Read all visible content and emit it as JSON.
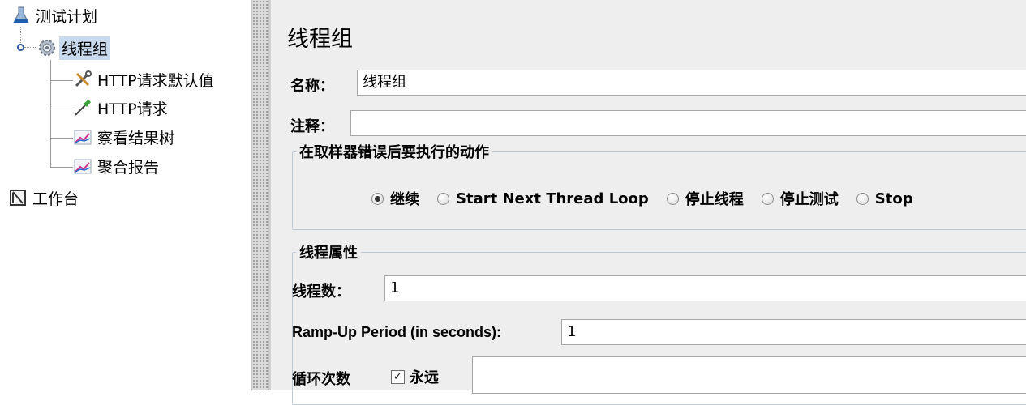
{
  "tree": {
    "items": [
      {
        "label": "测试计划",
        "icon": "test-plan-flask-icon"
      },
      {
        "label": "线程组",
        "icon": "gear-icon"
      },
      {
        "label": "HTTP请求默认值",
        "icon": "tools-wrench-icon"
      },
      {
        "label": "HTTP请求",
        "icon": "pipette-icon"
      },
      {
        "label": "察看结果树",
        "icon": "graph-icon"
      },
      {
        "label": "聚合报告",
        "icon": "graph-icon"
      },
      {
        "label": "工作台",
        "icon": "workbench-icon"
      }
    ]
  },
  "panel": {
    "title": "线程组",
    "name_label": "名称：",
    "name_value": "线程组",
    "comment_label": "注释：",
    "comment_value": "",
    "error_action": {
      "legend": "在取样器错误后要执行的动作",
      "options": [
        "继续",
        "Start Next Thread Loop",
        "停止线程",
        "停止测试",
        "Stop"
      ],
      "selected": "继续"
    },
    "thread_props": {
      "legend": "线程属性",
      "threads_label": "线程数：",
      "threads_value": "1",
      "rampup_label": "Ramp-Up Period (in seconds):",
      "rampup_value": "1",
      "loop_label": "循环次数",
      "forever_label": "永远",
      "forever_checked": true,
      "loop_value": ""
    }
  },
  "colors": {
    "selection": "#c9d9ee",
    "panel_bg": "#eeeeee",
    "border": "#a6a6a6"
  }
}
